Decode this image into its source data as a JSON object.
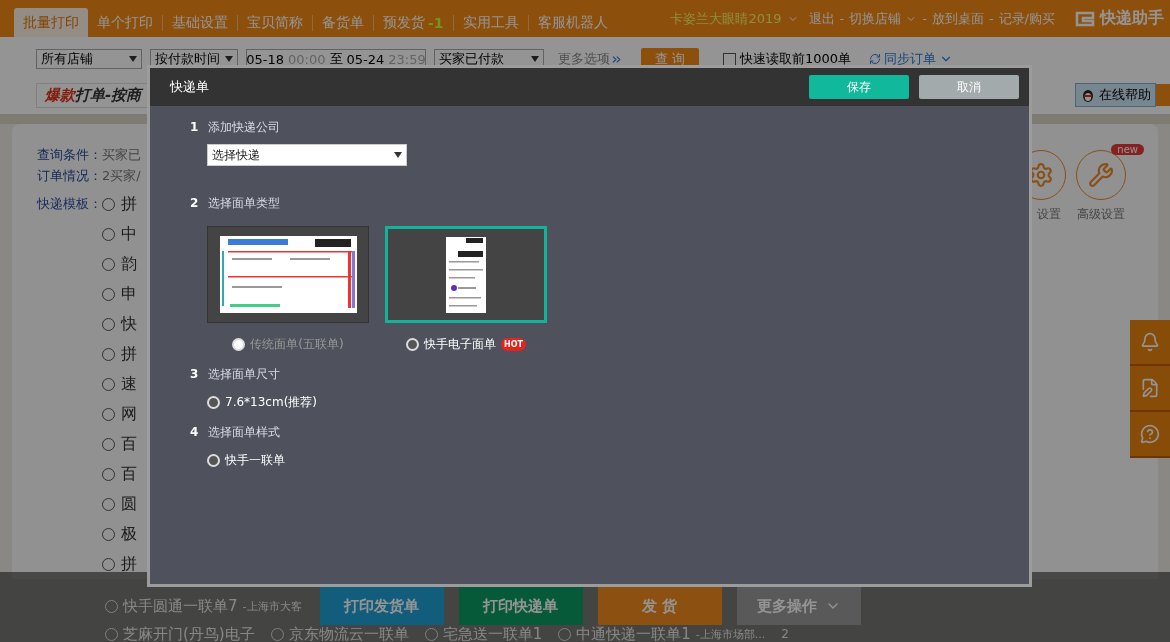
{
  "nav": {
    "tabs": [
      {
        "label": "批量打印",
        "selected": true
      },
      {
        "label": "单个打印",
        "selected": false
      },
      {
        "label": "基础设置",
        "selected": false
      },
      {
        "label": "宝贝简称",
        "selected": false
      },
      {
        "label": "备货单",
        "selected": false
      },
      {
        "label": "预发货",
        "selected": false,
        "badge": "-1"
      },
      {
        "label": "实用工具",
        "selected": false
      },
      {
        "label": "客服机器人",
        "selected": false
      }
    ],
    "user": "卡姿兰大眼睛2019",
    "links": [
      {
        "label": "退出",
        "caret": false
      },
      {
        "label": "切换店铺",
        "caret": true
      },
      {
        "label": "放到桌面",
        "caret": false
      },
      {
        "label": "记录/购买",
        "caret": false
      }
    ],
    "separator": "-",
    "brand": "快递助手"
  },
  "filters": {
    "shop": "所有店铺",
    "time_type": "按付款时间",
    "date_from": "05-18",
    "time_from": "00:00",
    "range_word": "至",
    "date_to": "05-24",
    "time_to": "23:59",
    "status": "买家已付款",
    "more": "更多选项",
    "query": "查 询",
    "fast_read": {
      "label": "快速读取前1000单",
      "checked": false
    },
    "sync": "同步订单"
  },
  "banner": {
    "hot": "爆款",
    "rest": "打单-按商"
  },
  "help": "在线帮助",
  "panel": {
    "fields": [
      {
        "label": "查询条件：",
        "value": "买家已"
      },
      {
        "label": "订单情况：",
        "value": "2买家/"
      }
    ],
    "templates_label": "快递模板：",
    "templates": [
      "拼",
      "中",
      "韵",
      "申",
      "快",
      "拼",
      "速",
      "网",
      "百",
      "百",
      "圆",
      "极",
      "拼"
    ],
    "tools": [
      {
        "label": "设置"
      },
      {
        "label": "高级设置",
        "badge": "new"
      }
    ]
  },
  "footer": {
    "row1": [
      {
        "name": "快手圆通一联单7",
        "note": "-上海市大客"
      }
    ],
    "row2": [
      {
        "name": "芝麻开门(丹鸟)电子"
      },
      {
        "name": "京东物流云一联单"
      },
      {
        "name": "宅急送一联单1"
      },
      {
        "name": "中通快递一联单1",
        "note": "-上海市场部..."
      }
    ],
    "row2_count": "2",
    "buttons": [
      {
        "label": "打印发货单",
        "kind": "print"
      },
      {
        "label": "打印快递单",
        "kind": "label"
      },
      {
        "label": "发 货",
        "kind": "ship"
      },
      {
        "label": "更多操作",
        "kind": "more"
      }
    ]
  },
  "modal": {
    "title": "快递单",
    "save": "保存",
    "cancel": "取消",
    "sections": [
      {
        "num": "1",
        "label": "添加快递公司",
        "kind": "select",
        "value": "选择快递"
      },
      {
        "num": "2",
        "label": "选择面单类型",
        "kind": "cards",
        "options": [
          {
            "label": "传统面单(五联单)",
            "selected": false
          },
          {
            "label": "快手电子面单",
            "selected": true,
            "badge": "HOT"
          }
        ]
      },
      {
        "num": "3",
        "label": "选择面单尺寸",
        "kind": "radio",
        "options": [
          {
            "label": "7.6*13cm(推荐)",
            "selected": true
          }
        ]
      },
      {
        "num": "4",
        "label": "选择面单样式",
        "kind": "radio",
        "options": [
          {
            "label": "快手一联单",
            "selected": true
          }
        ]
      }
    ]
  }
}
